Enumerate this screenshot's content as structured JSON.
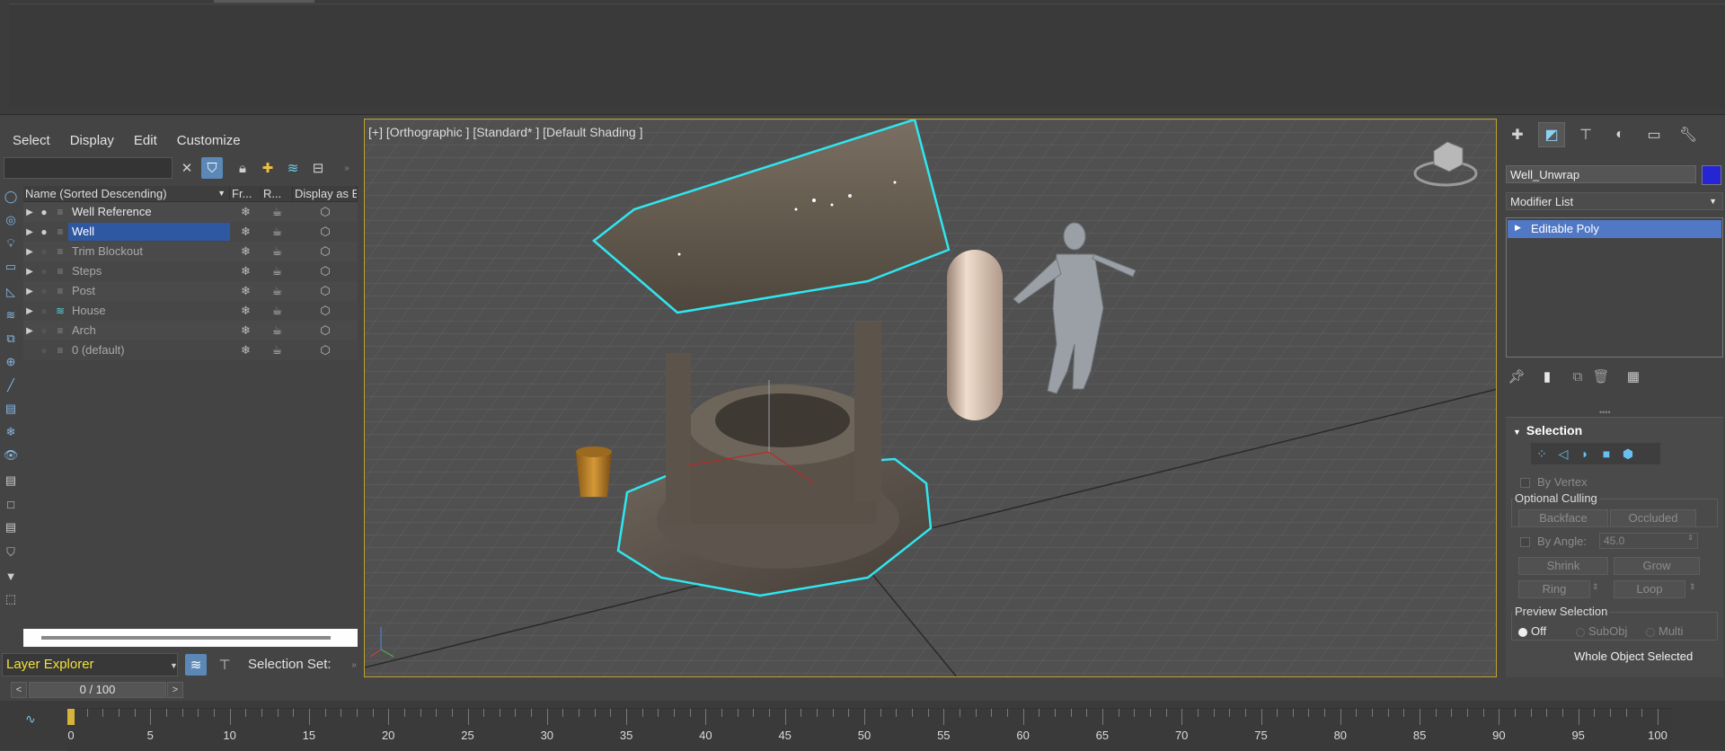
{
  "left_panel": {
    "menu": [
      "Select",
      "Display",
      "Edit",
      "Customize"
    ],
    "columns": [
      "Name (Sorted Descending)",
      "Fr...",
      "R...",
      "Display as B"
    ],
    "rows": [
      {
        "name": "Well Reference",
        "visible": true,
        "bright": true,
        "selected": false
      },
      {
        "name": "Well",
        "visible": true,
        "bright": true,
        "selected": true
      },
      {
        "name": "Trim Blockout",
        "visible": false,
        "bright": false,
        "selected": false
      },
      {
        "name": "Steps",
        "visible": false,
        "bright": false,
        "selected": false
      },
      {
        "name": "Post",
        "visible": false,
        "bright": false,
        "selected": false
      },
      {
        "name": "House",
        "visible": false,
        "bright": false,
        "selected": false
      },
      {
        "name": "Arch",
        "visible": false,
        "bright": false,
        "selected": false
      },
      {
        "name": "0 (default)",
        "visible": false,
        "bright": false,
        "selected": false
      }
    ],
    "layer_explorer": "Layer Explorer",
    "selection_set_label": "Selection Set:"
  },
  "viewport": {
    "label": "[+] [Orthographic ] [Standard* ] [Default Shading ]"
  },
  "command_panel": {
    "object_name": "Well_Unwrap",
    "object_color": "#2525d6",
    "modifier_list": "Modifier List",
    "stack_item": "Editable Poly",
    "selection": {
      "title": "Selection",
      "by_vertex": "By Vertex",
      "optional_culling": "Optional Culling",
      "backface": "Backface",
      "occluded": "Occluded",
      "by_angle": "By Angle:",
      "angle_value": "45.0",
      "shrink": "Shrink",
      "grow": "Grow",
      "ring": "Ring",
      "loop": "Loop",
      "preview_selection": "Preview Selection",
      "off": "Off",
      "subobj": "SubObj",
      "multi": "Multi",
      "status": "Whole Object Selected"
    }
  },
  "timeline": {
    "frame_display": "0 / 100",
    "ticks": [
      "0",
      "5",
      "10",
      "15",
      "20",
      "25",
      "30",
      "35",
      "40",
      "45",
      "50",
      "55",
      "60",
      "65",
      "70",
      "75",
      "80",
      "85",
      "90",
      "95",
      "100"
    ]
  },
  "colors": {
    "selection_outline": "#2fe6f0",
    "viewport_border": "#c0a030",
    "layer_explorer_text": "#f3e03b"
  }
}
